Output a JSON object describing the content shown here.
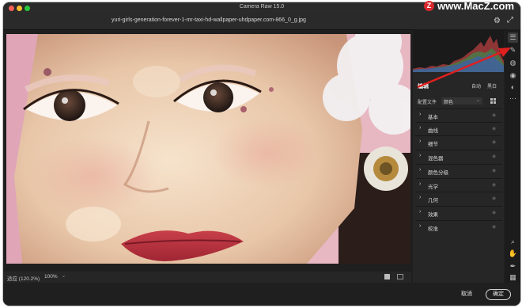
{
  "window": {
    "title": "Camera Raw 15.0",
    "filename": "yuri-girls-generation-forever-1-mr-taxi-hd-wallpaper-uhdpaper.com-866_0_g.jpg"
  },
  "watermark": {
    "logo_letter": "Z",
    "text": "www.MacZ.com"
  },
  "bottom_bar": {
    "zoom_label": "适应 (120.2%)",
    "zoom_value": "100%"
  },
  "footer": {
    "cancel_label": "取消",
    "ok_label": "确定"
  },
  "edit_panel": {
    "title": "编辑",
    "auto_label": "自动",
    "bw_label": "黑白",
    "profile_label": "配置文件",
    "profile_value": "颜色",
    "sections": [
      "基本",
      "曲线",
      "细节",
      "混色器",
      "颜色分级",
      "光学",
      "几何",
      "效果",
      "校准"
    ]
  },
  "toolstrip": {
    "top_icons": [
      "edit-sliders-icon",
      "healing-brush-icon",
      "masking-icon",
      "redeye-icon",
      "presets-icon",
      "more-icon"
    ],
    "bottom_icons": [
      "zoom-icon",
      "hand-icon",
      "eyedropper-icon",
      "grid-icon"
    ]
  },
  "colors": {
    "window_bg": "#1f1f1f",
    "panel_bg": "#262626",
    "annotation_arrow": "#e0201f",
    "ok_button_border": "#d8d8d8"
  }
}
